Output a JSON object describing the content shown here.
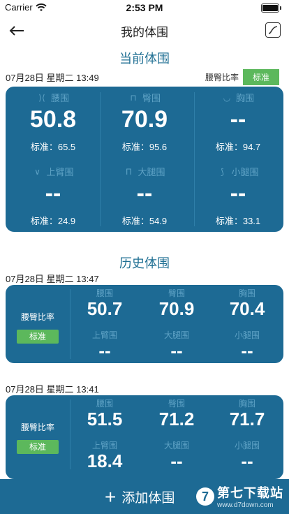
{
  "status": {
    "carrier": "Carrier",
    "time": "2:53 PM"
  },
  "nav": {
    "title": "我的体围"
  },
  "current": {
    "section_title": "当前体围",
    "timestamp": "07月28日 星期二 13:49",
    "ratio_label": "腰臀比率",
    "ratio_status": "标准",
    "cells": [
      {
        "label": "腰围",
        "value": "50.8",
        "standard": "标准：65.5",
        "icon": "waist-icon",
        "glyph": "⟩⟨"
      },
      {
        "label": "臀围",
        "value": "70.9",
        "standard": "标准：95.6",
        "icon": "hip-icon",
        "glyph": "⊓"
      },
      {
        "label": "胸围",
        "value": "--",
        "standard": "标准：94.7",
        "icon": "chest-icon",
        "glyph": "◡"
      },
      {
        "label": "上臂围",
        "value": "--",
        "standard": "标准：24.9",
        "icon": "upper-arm-icon",
        "glyph": "∨"
      },
      {
        "label": "大腿围",
        "value": "--",
        "standard": "标准：54.9",
        "icon": "thigh-icon",
        "glyph": "Π"
      },
      {
        "label": "小腿围",
        "value": "--",
        "standard": "标准：33.1",
        "icon": "calf-icon",
        "glyph": "⟆"
      }
    ]
  },
  "history": {
    "section_title": "历史体围",
    "records": [
      {
        "timestamp": "07月28日 星期二 13:47",
        "ratio_label": "腰臀比率",
        "ratio_status": "标准",
        "cells": [
          {
            "label": "腰围",
            "value": "50.7"
          },
          {
            "label": "臀围",
            "value": "70.9"
          },
          {
            "label": "胸围",
            "value": "70.4"
          },
          {
            "label": "上臂围",
            "value": "--"
          },
          {
            "label": "大腿围",
            "value": "--"
          },
          {
            "label": "小腿围",
            "value": "--"
          }
        ]
      },
      {
        "timestamp": "07月28日 星期二 13:41",
        "ratio_label": "腰臀比率",
        "ratio_status": "标准",
        "cells": [
          {
            "label": "腰围",
            "value": "51.5"
          },
          {
            "label": "臀围",
            "value": "71.2"
          },
          {
            "label": "胸围",
            "value": "71.7"
          },
          {
            "label": "上臂围",
            "value": "18.4"
          },
          {
            "label": "大腿围",
            "value": "--"
          },
          {
            "label": "小腿围",
            "value": "--"
          }
        ]
      }
    ]
  },
  "add_button": {
    "label": "添加体围"
  },
  "watermark": {
    "main": "第七下载站",
    "sub": "www.d7down.com",
    "logo": "7"
  },
  "colors": {
    "primary": "#1d6a94",
    "badge": "#5cb85c",
    "label": "#5ea2c5",
    "title": "#1f6f93"
  }
}
